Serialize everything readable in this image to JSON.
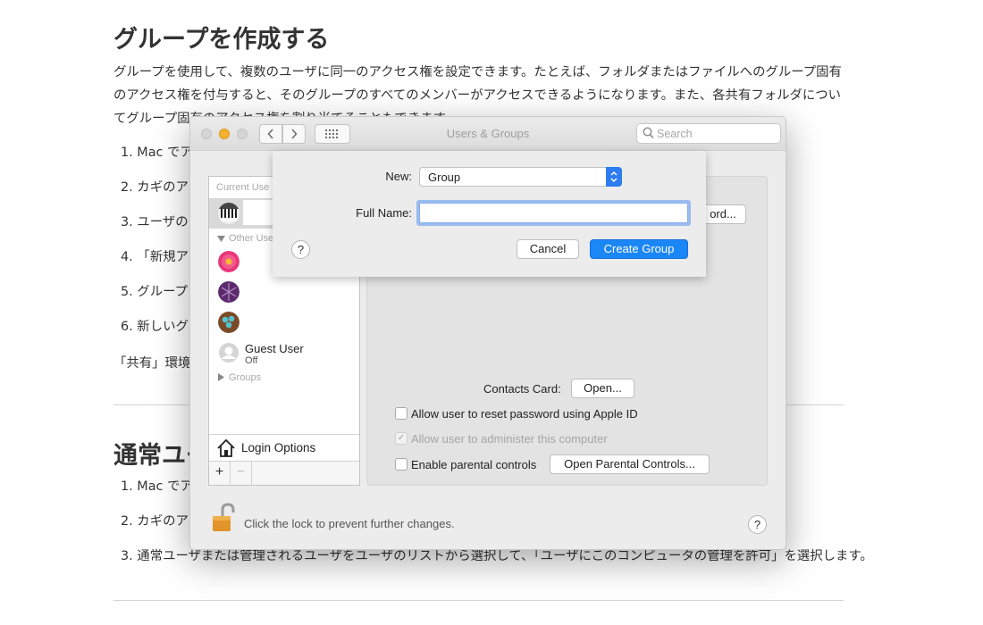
{
  "document": {
    "title": "グループを作成する",
    "intro": "グループを使用して、複数のユーザに同一のアクセス権を設定できます。たとえば、フォルダまたはファイルへのグループ固有のアクセス権を付与すると、そのグループのすべてのメンバーがアクセスできるようになります。また、各共有フォルダについてグループ固有のアクセス権を割り当てることもできます。",
    "steps": [
      "1. Mac でア",
      "2. カギのア",
      "3. ユーザの",
      "4. 「新規アカ",
      "5. グループ",
      "6. 新しいグ"
    ],
    "note": "「共有」環境設",
    "note_tail": "。",
    "section2_title": "通常ユー",
    "steps2": [
      "1. Mac でア",
      "2. カギのア",
      "3. 通常ユーザまたは管理されるユーザをユーザのリストから選択して、「ユーザにこのコンピュータの管理を許可」を選択します。"
    ]
  },
  "window": {
    "title": "Users & Groups",
    "search_placeholder": "Search",
    "sidebar": {
      "current_user_header": "Current Use",
      "other_users_header": "Other Use",
      "guest_name": "Guest User",
      "guest_status": "Off",
      "groups_header": "Groups",
      "login_options": "Login Options",
      "add": "+",
      "remove": "−"
    },
    "panel": {
      "password_button": "ord...",
      "contacts_label": "Contacts Card:",
      "open_button": "Open...",
      "checkbox_reset": "Allow user to reset password using Apple ID",
      "checkbox_admin": "Allow user to administer this computer",
      "checkbox_parental": "Enable parental controls",
      "parental_button": "Open Parental Controls..."
    },
    "lock_text": "Click the lock to prevent further changes.",
    "help": "?"
  },
  "sheet": {
    "new_label": "New:",
    "new_value": "Group",
    "full_name_label": "Full Name:",
    "full_name_value": "",
    "help": "?",
    "cancel_button": "Cancel",
    "create_button": "Create Group"
  },
  "colors": {
    "accent": "#1b86f5",
    "minimize": "#f5b12f"
  }
}
